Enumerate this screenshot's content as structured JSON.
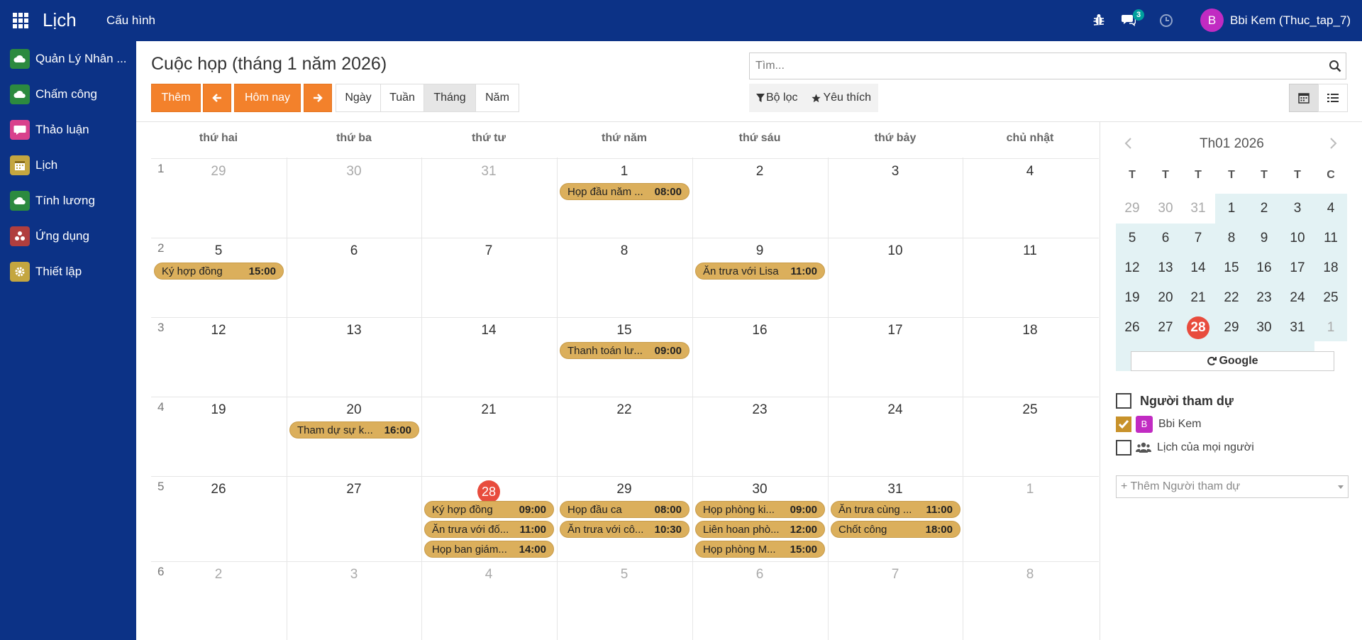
{
  "app": {
    "title": "Lịch",
    "menu": "Cấu hình"
  },
  "topbar": {
    "chat_count": "3",
    "user_initial": "B",
    "user_name": "Bbi Kem (Thuc_tap_7)"
  },
  "sidebar": {
    "items": [
      {
        "label": "Quản Lý Nhân ...",
        "icon": "cloud-icon",
        "color": "#2c8a3f"
      },
      {
        "label": "Chấm công",
        "icon": "cloud-icon",
        "color": "#2c8a3f"
      },
      {
        "label": "Thảo luận",
        "icon": "chat-icon",
        "color": "#d9418c"
      },
      {
        "label": "Lịch",
        "icon": "calendar-icon",
        "color": "#c4a640"
      },
      {
        "label": "Tính lương",
        "icon": "cloud-icon",
        "color": "#2c8a3f"
      },
      {
        "label": "Ứng dụng",
        "icon": "apps-icon",
        "color": "#b03e3e"
      },
      {
        "label": "Thiết lập",
        "icon": "gear-icon",
        "color": "#c4a640"
      }
    ]
  },
  "header": {
    "title": "Cuộc họp (tháng 1 năm 2026)",
    "add_label": "Thêm",
    "today_label": "Hôm nay",
    "scales": [
      "Ngày",
      "Tuần",
      "Tháng",
      "Năm"
    ],
    "active_scale": "Tháng",
    "search_placeholder": "Tìm...",
    "filter_label": "Bộ lọc",
    "favorite_label": "Yêu thích"
  },
  "calendar": {
    "day_headers": [
      "thứ hai",
      "thứ ba",
      "thứ tư",
      "thứ năm",
      "thứ sáu",
      "thứ bảy",
      "chủ nhật"
    ],
    "weeks": [
      {
        "num": "1",
        "days": [
          {
            "d": "29",
            "other": true
          },
          {
            "d": "30",
            "other": true
          },
          {
            "d": "31",
            "other": true
          },
          {
            "d": "1",
            "events": [
              {
                "title": "Họp đầu năm ...",
                "time": "08:00"
              }
            ]
          },
          {
            "d": "2"
          },
          {
            "d": "3"
          },
          {
            "d": "4"
          }
        ]
      },
      {
        "num": "2",
        "days": [
          {
            "d": "5",
            "events": [
              {
                "title": "Ký hợp đồng",
                "time": "15:00"
              }
            ]
          },
          {
            "d": "6"
          },
          {
            "d": "7"
          },
          {
            "d": "8"
          },
          {
            "d": "9",
            "events": [
              {
                "title": "Ăn trưa với Lisa",
                "time": "11:00"
              }
            ]
          },
          {
            "d": "10"
          },
          {
            "d": "11"
          }
        ]
      },
      {
        "num": "3",
        "days": [
          {
            "d": "12"
          },
          {
            "d": "13"
          },
          {
            "d": "14"
          },
          {
            "d": "15",
            "events": [
              {
                "title": "Thanh toán lư...",
                "time": "09:00"
              }
            ]
          },
          {
            "d": "16"
          },
          {
            "d": "17"
          },
          {
            "d": "18"
          }
        ]
      },
      {
        "num": "4",
        "days": [
          {
            "d": "19"
          },
          {
            "d": "20",
            "events": [
              {
                "title": "Tham dự sự k...",
                "time": "16:00"
              }
            ]
          },
          {
            "d": "21"
          },
          {
            "d": "22"
          },
          {
            "d": "23"
          },
          {
            "d": "24"
          },
          {
            "d": "25"
          }
        ]
      },
      {
        "num": "5",
        "days": [
          {
            "d": "26"
          },
          {
            "d": "27"
          },
          {
            "d": "28",
            "today": true,
            "events": [
              {
                "title": "Ký hợp đồng",
                "time": "09:00"
              },
              {
                "title": "Ăn trưa với đố...",
                "time": "11:00"
              },
              {
                "title": "Họp ban giám...",
                "time": "14:00"
              }
            ]
          },
          {
            "d": "29",
            "events": [
              {
                "title": "Họp đầu ca",
                "time": "08:00"
              },
              {
                "title": "Ăn trưa với cô...",
                "time": "10:30"
              }
            ]
          },
          {
            "d": "30",
            "events": [
              {
                "title": "Họp phòng ki...",
                "time": "09:00"
              },
              {
                "title": "Liên hoan phò...",
                "time": "12:00"
              },
              {
                "title": "Họp phòng M...",
                "time": "15:00"
              }
            ]
          },
          {
            "d": "31",
            "events": [
              {
                "title": "Ăn trưa cùng ...",
                "time": "11:00"
              },
              {
                "title": "Chốt công",
                "time": "18:00"
              }
            ]
          },
          {
            "d": "1",
            "other": true
          }
        ]
      },
      {
        "num": "6",
        "days": [
          {
            "d": "2",
            "other": true
          },
          {
            "d": "3",
            "other": true
          },
          {
            "d": "4",
            "other": true
          },
          {
            "d": "5",
            "other": true
          },
          {
            "d": "6",
            "other": true
          },
          {
            "d": "7",
            "other": true
          },
          {
            "d": "8",
            "other": true
          }
        ]
      }
    ]
  },
  "mini_calendar": {
    "title": "Th01 2026",
    "dow": [
      "T",
      "T",
      "T",
      "T",
      "T",
      "T",
      "C"
    ],
    "weeks": [
      [
        "29",
        "30",
        "31",
        "1",
        "2",
        "3",
        "4"
      ],
      [
        "5",
        "6",
        "7",
        "8",
        "9",
        "10",
        "11"
      ],
      [
        "12",
        "13",
        "14",
        "15",
        "16",
        "17",
        "18"
      ],
      [
        "19",
        "20",
        "21",
        "22",
        "23",
        "24",
        "25"
      ],
      [
        "26",
        "27",
        "28",
        "29",
        "30",
        "31",
        "1"
      ]
    ],
    "today": "28",
    "google_label": "Google"
  },
  "attendees": {
    "title": "Người tham dự",
    "items": [
      {
        "label": "Bbi Kem",
        "initial": "B",
        "checked": true
      },
      {
        "label": "Lịch của mọi người",
        "checked": false
      }
    ],
    "add_placeholder": "+ Thêm Người tham dự"
  }
}
